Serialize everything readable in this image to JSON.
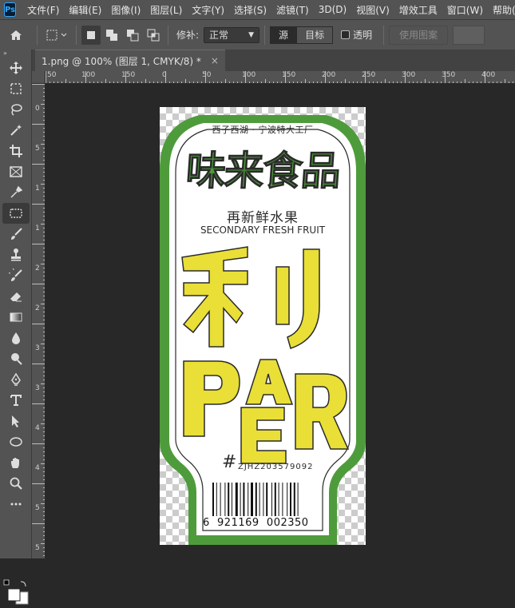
{
  "app": {
    "logo": "Ps"
  },
  "menu": [
    "文件(F)",
    "编辑(E)",
    "图像(I)",
    "图层(L)",
    "文字(Y)",
    "选择(S)",
    "滤镜(T)",
    "3D(D)",
    "视图(V)",
    "增效工具",
    "窗口(W)",
    "帮助(H)"
  ],
  "options": {
    "feather_label": "修补:",
    "mode_value": "正常",
    "source_label": "源",
    "target_label": "目标",
    "transparent_label": "透明",
    "use_pattern_label": "使用图案"
  },
  "tab": {
    "title": "1.png @ 100% (图层 1, CMYK/8) *",
    "close": "×"
  },
  "ruler": {
    "h_labels": [
      "50",
      "100",
      "150",
      "0",
      "50",
      "100",
      "150",
      "200",
      "250",
      "300",
      "350",
      "400"
    ],
    "v_labels": [
      "0",
      "5",
      "1",
      "1",
      "2",
      "2",
      "3",
      "3",
      "4",
      "4",
      "5",
      "5"
    ]
  },
  "label": {
    "factory": "西子西湖 · 宁波特大工厂",
    "brand": "味来食品",
    "subtitle": "再新鲜水果",
    "english": "SECONDARY FRESH FRUIT",
    "product": "利",
    "letters": [
      "P",
      "A",
      "E",
      "R"
    ],
    "hash": "#",
    "code": "ZJHZ203579092",
    "barcode_number": "6  921169  002350"
  },
  "colors": {
    "green": "#4e9b3c",
    "yellow": "#e9df37",
    "outline": "#2b2b2b"
  },
  "tools": [
    "move-icon",
    "marquee-icon",
    "lasso-icon",
    "magic-wand-icon",
    "crop-icon",
    "frame-icon",
    "eyedropper-icon",
    "patch-icon",
    "brush-icon",
    "stamp-icon",
    "history-brush-icon",
    "eraser-icon",
    "gradient-icon",
    "blur-icon",
    "dodge-icon",
    "pen-icon",
    "type-icon",
    "path-select-icon",
    "ellipse-icon",
    "hand-icon",
    "zoom-icon",
    "more-icon"
  ]
}
